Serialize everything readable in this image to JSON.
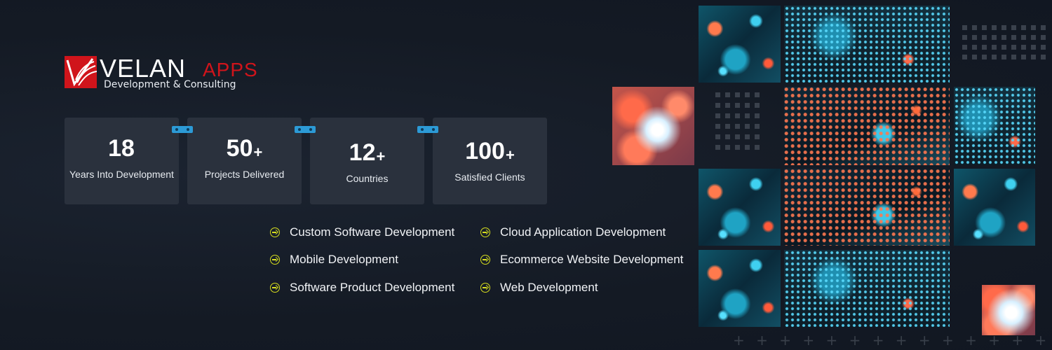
{
  "brand": {
    "name_main": "VELAN",
    "name_accent": "APPS",
    "tagline": "Development & Consulting",
    "accent_color": "#d0141b"
  },
  "stats": [
    {
      "number": "18",
      "plus": "",
      "label": "Years Into Development"
    },
    {
      "number": "50",
      "plus": "+",
      "label": "Projects Delivered"
    },
    {
      "number": "12",
      "plus": "+",
      "label": "Countries"
    },
    {
      "number": "100",
      "plus": "+",
      "label": "Satisfied Clients"
    }
  ],
  "services": [
    {
      "label": "Custom Software Development",
      "icon": "arrow-circle-right-icon"
    },
    {
      "label": "Mobile Development",
      "icon": "arrow-circle-right-icon"
    },
    {
      "label": "Software Product Development",
      "icon": "arrow-circle-right-icon"
    },
    {
      "label": "Cloud Application Development",
      "icon": "arrow-circle-right-icon"
    },
    {
      "label": "Ecommerce Website Development",
      "icon": "arrow-circle-right-icon"
    },
    {
      "label": "Web Development",
      "icon": "arrow-circle-right-icon"
    }
  ],
  "decor": {
    "plus_pattern": "+ + + + + + + + + + + + + +",
    "icon_accent_color": "#d8df1e",
    "connector_color": "#2c9ad6"
  }
}
